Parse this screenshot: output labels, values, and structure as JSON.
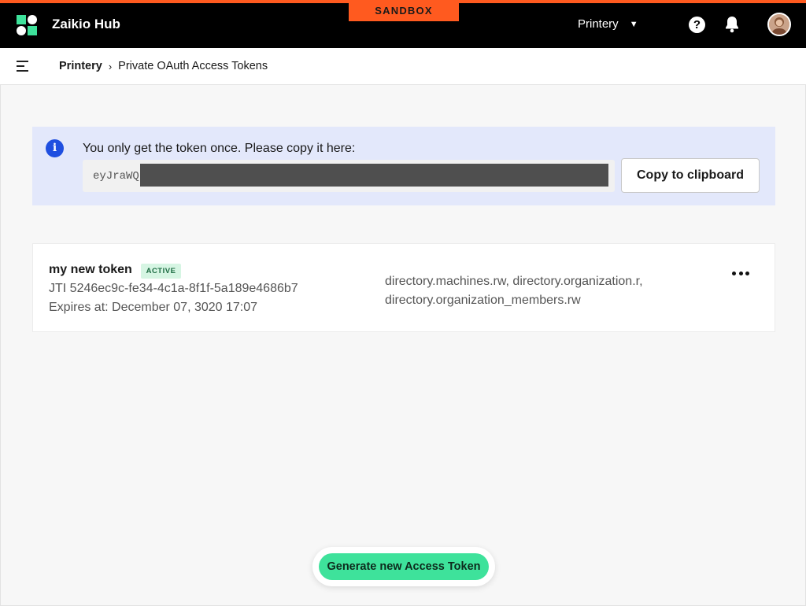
{
  "header": {
    "sandbox_label": "SANDBOX",
    "app_name": "Zaikio Hub",
    "org_name": "Printery",
    "help_symbol": "?",
    "icons": [
      "logo-icon",
      "chevron-down-icon",
      "help-icon",
      "bell-icon",
      "avatar"
    ]
  },
  "breadcrumb": {
    "root": "Printery",
    "separator": "›",
    "current": "Private OAuth Access Tokens"
  },
  "alert": {
    "message": "You only get the token once. Please copy it here:",
    "token_prefix": "eyJraWQ",
    "copy_label": "Copy to clipboard",
    "info_symbol": "i",
    "color": "#e3e8fb"
  },
  "token": {
    "name": "my new token",
    "status": "ACTIVE",
    "jti": "JTI 5246ec9c-fe34-4c1a-8f1f-5a189e4686b7",
    "expires": "Expires at: December 07, 3020 17:07",
    "scopes": "directory.machines.rw, directory.organization.r, directory.organization_members.rw"
  },
  "actions": {
    "generate_label": "Generate new Access Token",
    "accent": "#3ee29b"
  },
  "colors": {
    "topbar": "#000000",
    "sandbox": "#ff5a1f",
    "info": "#1f4fe0"
  }
}
